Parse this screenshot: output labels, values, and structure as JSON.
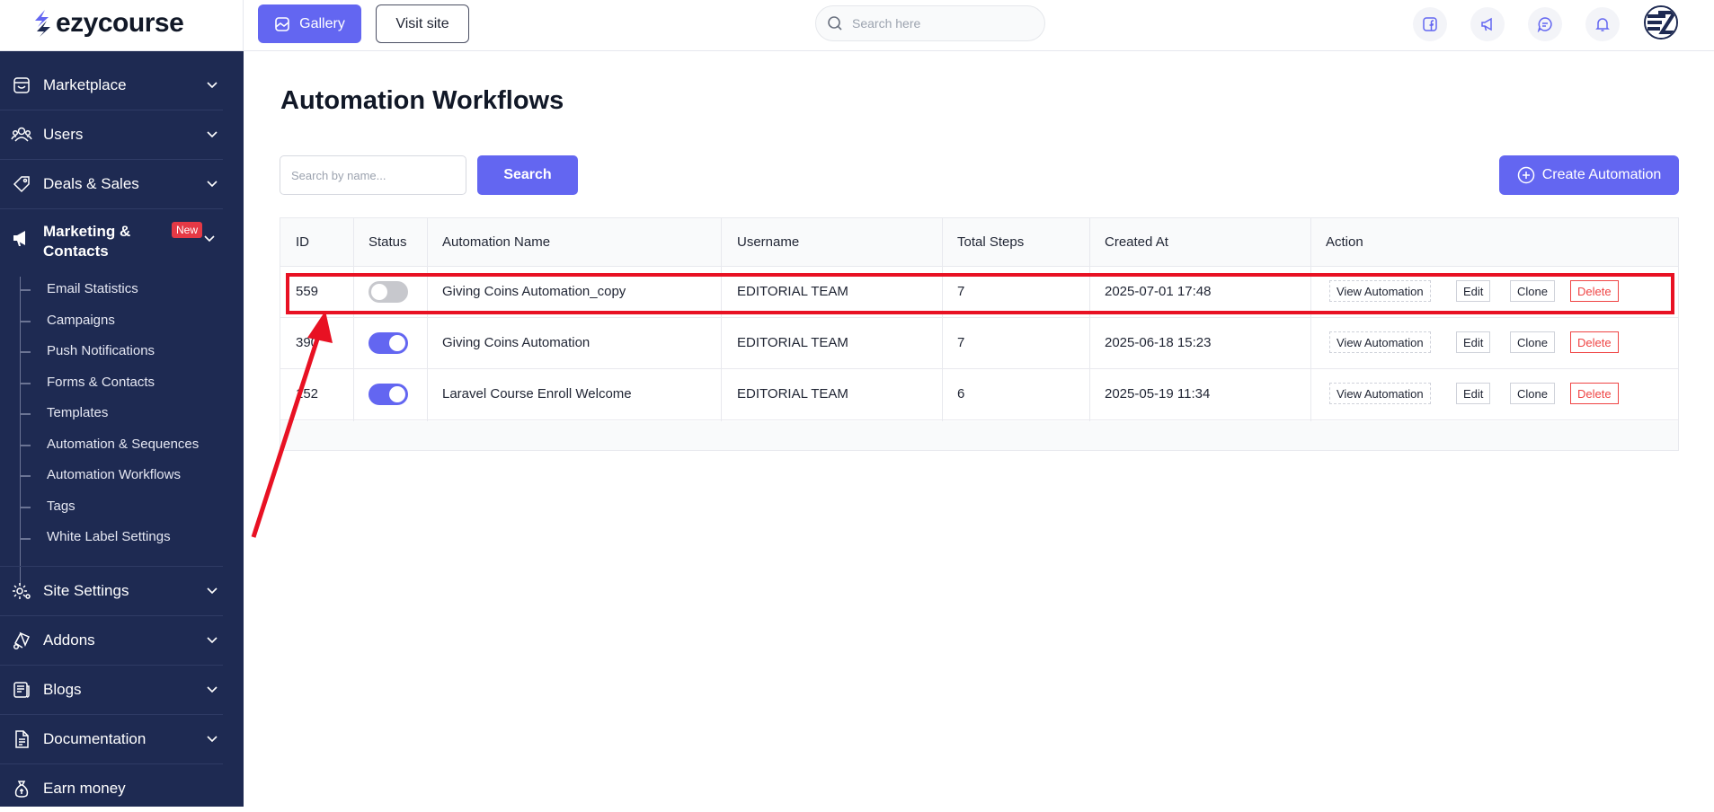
{
  "brand": {
    "name": "ezycourse"
  },
  "header": {
    "gallery_label": "Gallery",
    "visit_site_label": "Visit site",
    "search_placeholder": "Search here"
  },
  "sidebar": {
    "items": [
      {
        "label": "Marketplace",
        "icon": "shop-icon"
      },
      {
        "label": "Users",
        "icon": "users-icon"
      },
      {
        "label": "Deals & Sales",
        "icon": "tag-icon"
      },
      {
        "label": "Marketing & Contacts",
        "icon": "megaphone-icon",
        "badge": "New"
      },
      {
        "label": "Site Settings",
        "icon": "settings-icon"
      },
      {
        "label": "Addons",
        "icon": "addons-icon"
      },
      {
        "label": "Blogs",
        "icon": "blog-icon"
      },
      {
        "label": "Documentation",
        "icon": "document-icon"
      },
      {
        "label": "Earn money",
        "icon": "money-bag-icon"
      }
    ],
    "marketing_sub": [
      "Email Statistics",
      "Campaigns",
      "Push Notifications",
      "Forms & Contacts",
      "Templates",
      "Automation & Sequences",
      "Automation Workflows",
      "Tags",
      "White Label Settings"
    ]
  },
  "main": {
    "title": "Automation Workflows",
    "search_placeholder": "Search by name...",
    "search_button": "Search",
    "create_button": "Create Automation",
    "columns": [
      "ID",
      "Status",
      "Automation Name",
      "Username",
      "Total Steps",
      "Created At",
      "Action"
    ],
    "rows": [
      {
        "id": "559",
        "status": false,
        "name": "Giving Coins Automation_copy",
        "username": "EDITORIAL TEAM",
        "steps": "7",
        "created": "2025-07-01 17:48"
      },
      {
        "id": "390",
        "status": true,
        "name": "Giving Coins Automation",
        "username": "EDITORIAL TEAM",
        "steps": "7",
        "created": "2025-06-18 15:23"
      },
      {
        "id": "152",
        "status": true,
        "name": "Laravel Course Enroll Welcome",
        "username": "EDITORIAL TEAM",
        "steps": "6",
        "created": "2025-05-19 11:34"
      }
    ],
    "actions": {
      "view": "View Automation",
      "edit": "Edit",
      "clone": "Clone",
      "delete": "Delete"
    }
  },
  "colors": {
    "accent": "#6366f1",
    "sidebar": "#1e2a52",
    "danger": "#ef4444",
    "highlight": "#e81123"
  }
}
